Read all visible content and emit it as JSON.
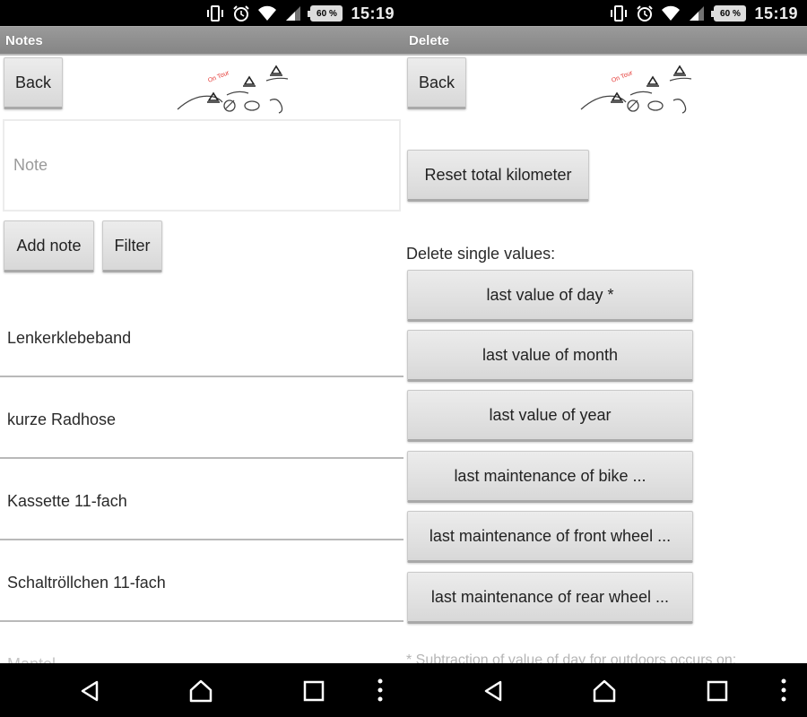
{
  "status_bar": {
    "icons": [
      "vibrate-icon",
      "alarm-icon",
      "wifi-icon",
      "signal-icon",
      "battery-icon"
    ],
    "battery_label": "60 %",
    "time": "15:19"
  },
  "left_screen": {
    "title": "Notes",
    "back_label": "Back",
    "note_input": {
      "placeholder": "Note",
      "value": ""
    },
    "add_note_label": "Add note",
    "filter_label": "Filter",
    "notes": [
      "Lenkerklebeband",
      "kurze Radhose",
      "Kassette 11-fach",
      "Schaltröllchen 11-fach",
      "Mantel"
    ]
  },
  "right_screen": {
    "title": "Delete",
    "back_label": "Back",
    "reset_label": "Reset total kilometer",
    "section_label": "Delete single values:",
    "delete_buttons": [
      "last value of day *",
      "last value of month",
      "last value of year",
      "last maintenance of bike ...",
      "last maintenance of front wheel ...",
      "last maintenance of rear wheel ..."
    ],
    "footnote": "* Subtraction of value of day for outdoors occurs on:"
  },
  "nav_bar": {
    "icons": [
      "back-icon",
      "home-icon",
      "recents-icon",
      "overflow-menu-icon"
    ]
  },
  "colors": {
    "title_bar": "#8f8f8f",
    "button_bg": "#e0e0e0",
    "logo_accent": "#e53935"
  }
}
